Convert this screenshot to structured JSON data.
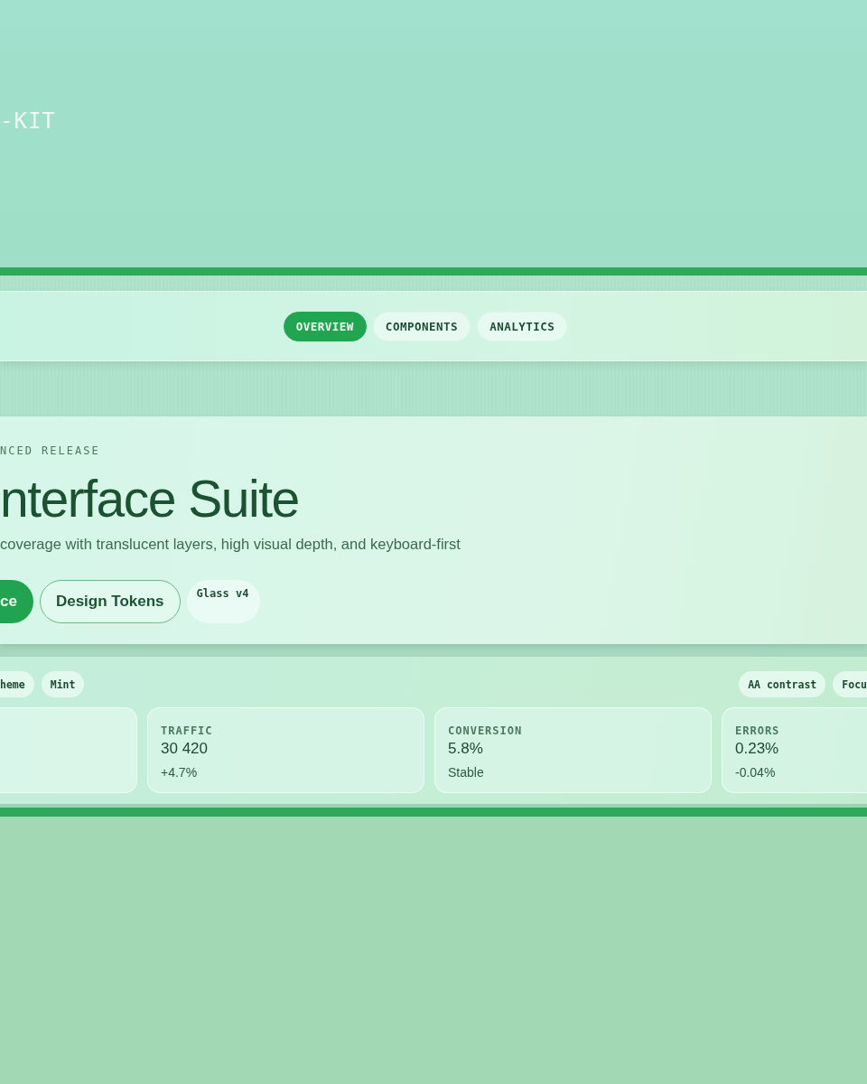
{
  "brand": {
    "text": "-KIT"
  },
  "nav": {
    "tabs": [
      {
        "label": "OVERVIEW",
        "selected": true
      },
      {
        "label": "COMPONENTS",
        "selected": false
      },
      {
        "label": "ANALYTICS",
        "selected": false
      }
    ]
  },
  "hero": {
    "eyebrow": "NCED RELEASE",
    "title": "nterface Suite",
    "subtitle": "coverage with translucent layers, high visual depth, and keyboard-first",
    "buttons": [
      {
        "label": "ce",
        "kind": "primary"
      },
      {
        "label": "Design Tokens",
        "kind": "outline"
      }
    ],
    "badge": "Glass v4"
  },
  "stats": {
    "tags_left": [
      "heme",
      "Mint"
    ],
    "tags_right": [
      "AA contrast",
      "Focu"
    ],
    "cards": [
      {
        "label": "TRAFFIC",
        "value": "30 420",
        "note": "+4.7%"
      },
      {
        "label": "CONVERSION",
        "value": "5.8%",
        "note": "Stable"
      },
      {
        "label": "ERRORS",
        "value": "0.23%",
        "note": "-0.04%"
      }
    ]
  }
}
